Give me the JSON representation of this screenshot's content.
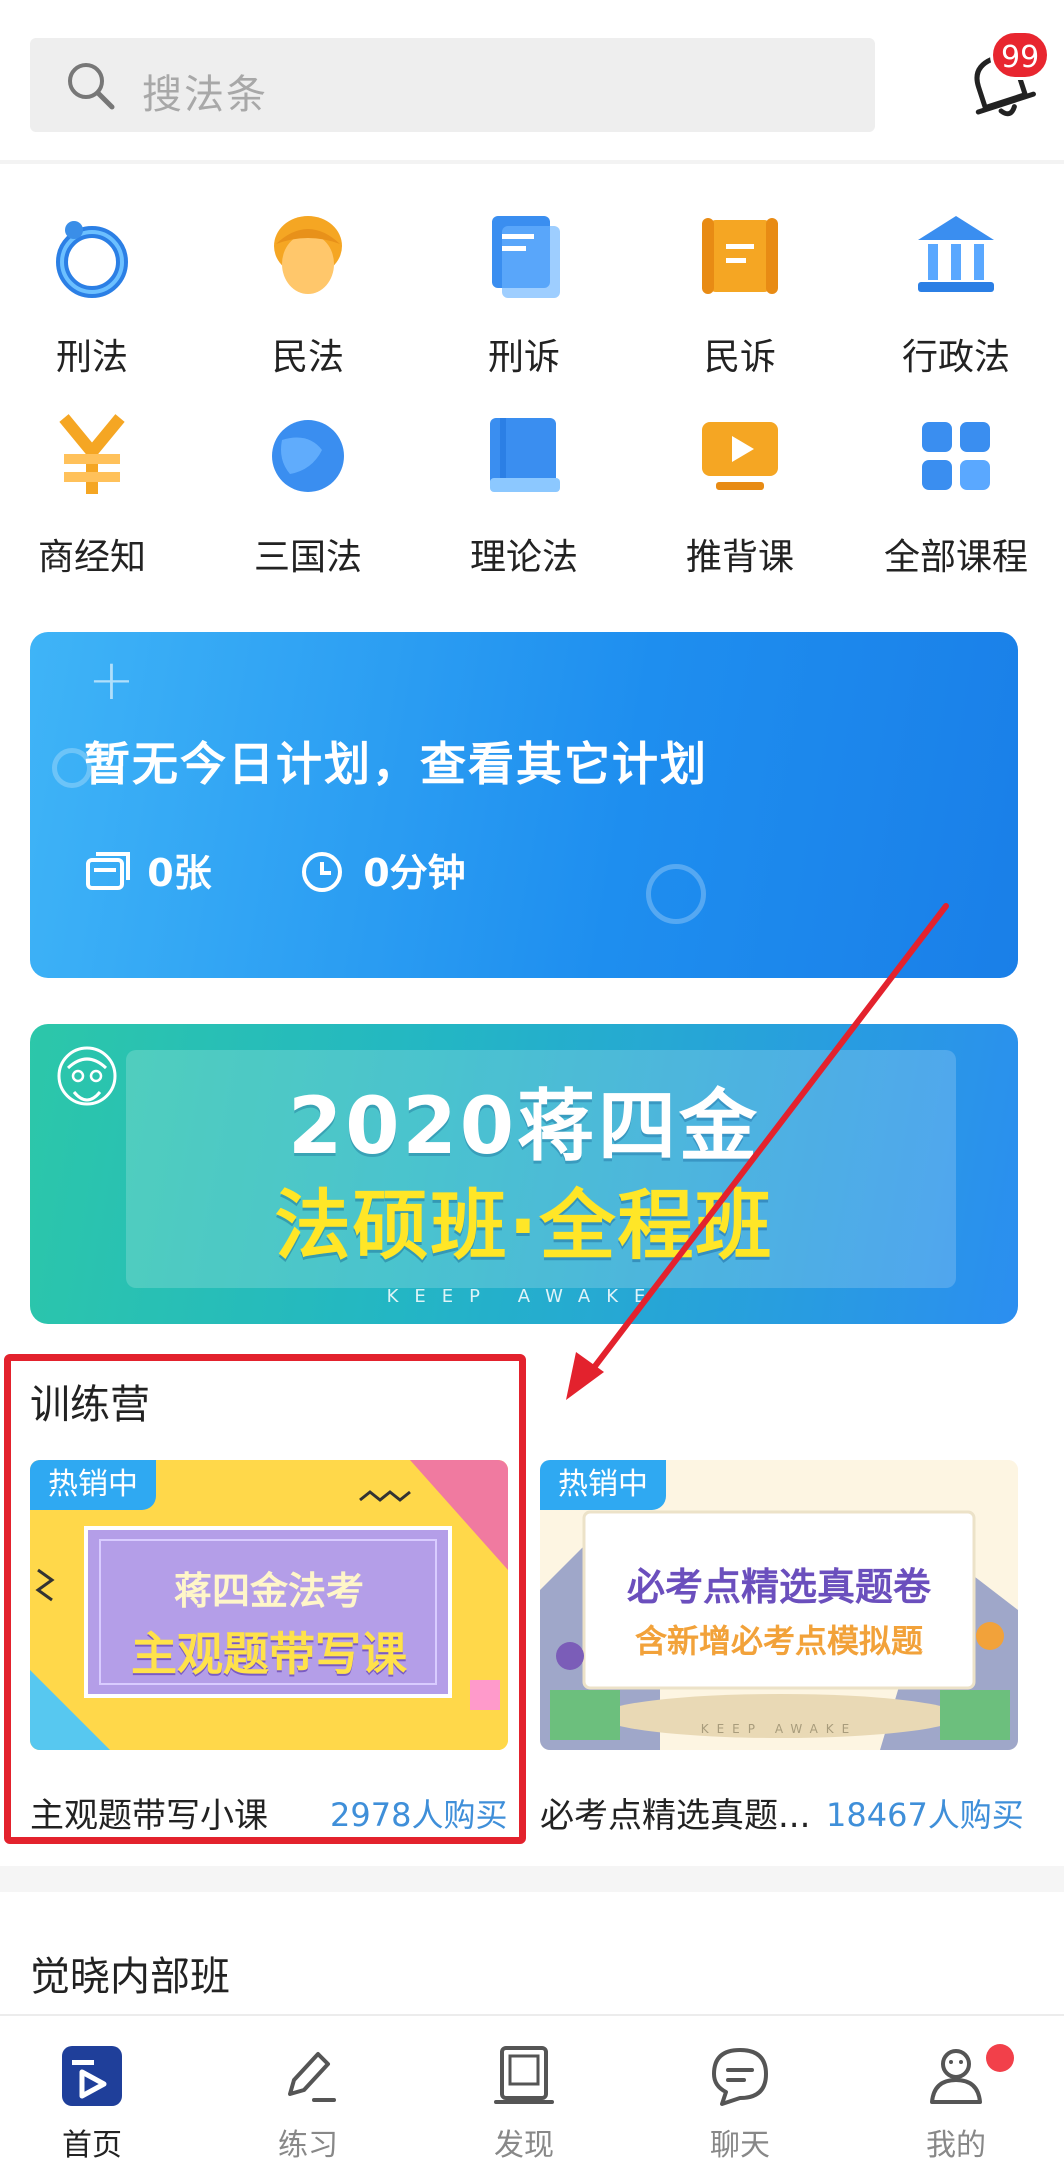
{
  "search": {
    "placeholder": "搜法条"
  },
  "notifications": {
    "badge": "99"
  },
  "categories": [
    {
      "label": "刑法",
      "icon": "ring-icon"
    },
    {
      "label": "民法",
      "icon": "person-icon"
    },
    {
      "label": "刑诉",
      "icon": "document-icon"
    },
    {
      "label": "民诉",
      "icon": "scroll-icon"
    },
    {
      "label": "行政法",
      "icon": "building-icon"
    },
    {
      "label": "商经知",
      "icon": "yuan-icon"
    },
    {
      "label": "三国法",
      "icon": "globe-icon"
    },
    {
      "label": "理论法",
      "icon": "book-icon"
    },
    {
      "label": "推背课",
      "icon": "video-icon"
    },
    {
      "label": "全部课程",
      "icon": "grid-icon"
    }
  ],
  "plan_card": {
    "title": "暂无今日计划，查看其它计划",
    "cards": "0张",
    "minutes": "0分钟"
  },
  "banner": {
    "line1": "2020蒋四金",
    "line2": "法硕班·全程班",
    "tagline": "KEEP AWAKE"
  },
  "training_camp": {
    "title": "训练营",
    "items": [
      {
        "tag": "热销中",
        "image_line1": "蒋四金法考",
        "image_line2": "主观题带写课",
        "name": "主观题带写小课",
        "buyers": "2978人购买"
      },
      {
        "tag": "热销中",
        "image_line1": "必考点精选真题卷",
        "image_line2": "含新增必考点模拟题",
        "image_tagline": "KEEP AWAKE",
        "name": "必考点精选真题...",
        "buyers": "18467人购买"
      }
    ]
  },
  "internal_class": {
    "title": "觉晓内部班"
  },
  "tabs": [
    {
      "label": "首页",
      "icon": "home-play-icon",
      "active": true
    },
    {
      "label": "练习",
      "icon": "pencil-icon",
      "active": false
    },
    {
      "label": "发现",
      "icon": "frame-icon",
      "active": false
    },
    {
      "label": "聊天",
      "icon": "chat-icon",
      "active": false
    },
    {
      "label": "我的",
      "icon": "profile-icon",
      "active": false
    }
  ],
  "colors": {
    "accent": "#1e8eef",
    "badge_red": "#e8262f",
    "link_blue": "#3f8fd9",
    "highlight_red": "#e3222d"
  }
}
